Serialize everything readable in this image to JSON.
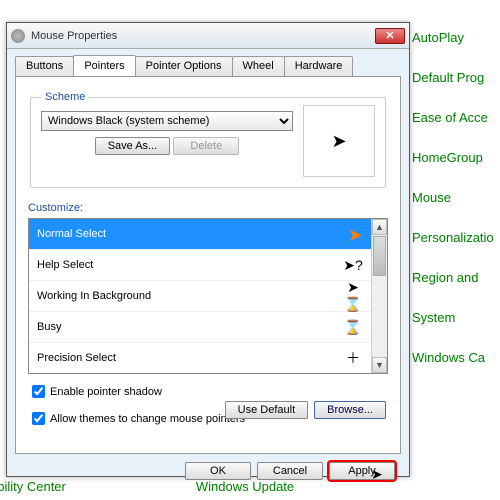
{
  "bg": {
    "links": [
      "AutoPlay",
      "Default Prog",
      "Ease of Acce",
      "HomeGroup",
      "Mouse",
      "Personalizatio",
      "Region and",
      "System",
      "Windows Ca"
    ],
    "bottom": [
      "obility Center",
      "Windows Update"
    ]
  },
  "dialog": {
    "title": "Mouse Properties",
    "tabs": [
      "Buttons",
      "Pointers",
      "Pointer Options",
      "Wheel",
      "Hardware"
    ],
    "activeTab": 1,
    "scheme": {
      "label": "Scheme",
      "value": "Windows Black (system scheme)",
      "save": "Save As...",
      "delete": "Delete"
    },
    "customizeLabel": "Customize:",
    "items": [
      {
        "label": "Normal Select",
        "selected": true,
        "icon": "arrow-orange"
      },
      {
        "label": "Help Select",
        "selected": false,
        "icon": "help"
      },
      {
        "label": "Working In Background",
        "selected": false,
        "icon": "work"
      },
      {
        "label": "Busy",
        "selected": false,
        "icon": "busy"
      },
      {
        "label": "Precision Select",
        "selected": false,
        "icon": "precision"
      }
    ],
    "check1": "Enable pointer shadow",
    "check2": "Allow themes to change mouse pointers",
    "useDefault": "Use Default",
    "browse": "Browse...",
    "ok": "OK",
    "cancel": "Cancel",
    "apply": "Apply"
  }
}
